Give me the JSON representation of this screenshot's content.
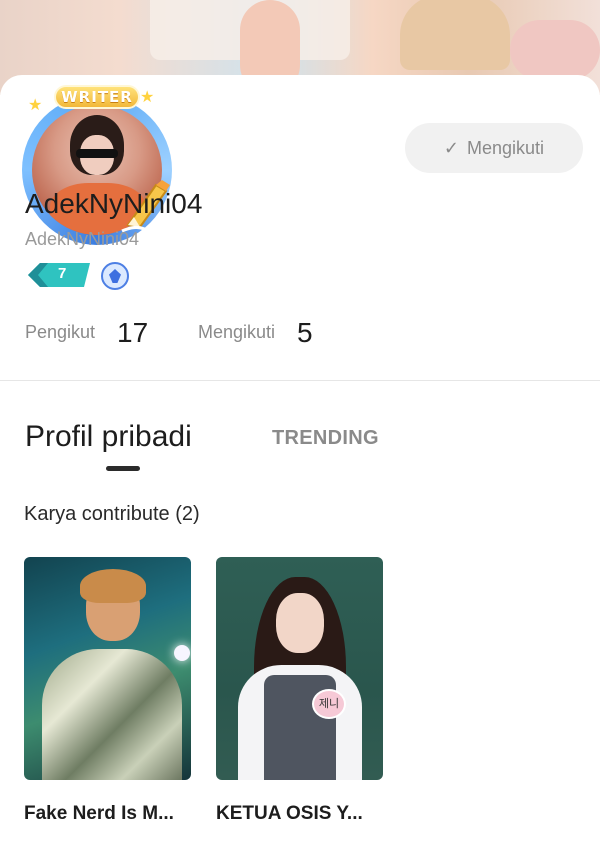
{
  "profile": {
    "writer_badge_label": "WRITER",
    "display_name": "AdekNyNini04",
    "username": "AdekNyNini04",
    "level": "7",
    "follow_button_label": "Mengikuti"
  },
  "stats": {
    "followers_label": "Pengikut",
    "followers_count": "17",
    "following_label": "Mengikuti",
    "following_count": "5"
  },
  "tabs": {
    "profile": "Profil pribadi",
    "trending": "TRENDING"
  },
  "works": {
    "section_title": "Karya contribute (2)",
    "items": [
      {
        "title": "Fake Nerd Is M..."
      },
      {
        "title": "KETUA OSIS Y..."
      }
    ],
    "name_tag": "제니"
  },
  "colors": {
    "accent_blue": "#4d7fe4",
    "badge_teal": "#2fc3c0",
    "writer_gold": "#f2b83a"
  }
}
